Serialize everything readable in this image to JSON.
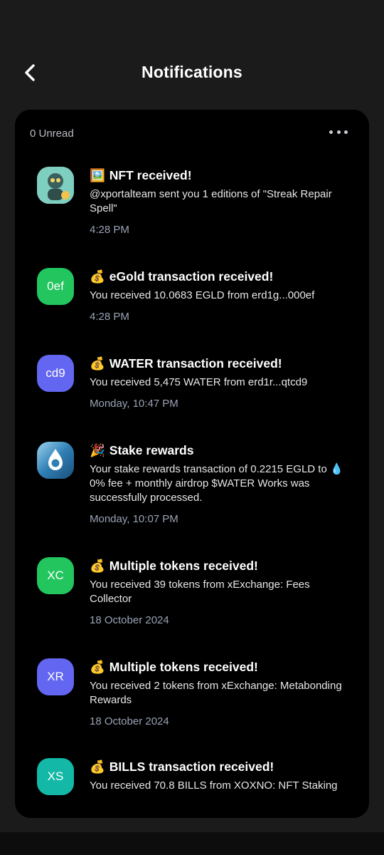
{
  "header": {
    "title": "Notifications",
    "back_icon": "back-arrow-icon"
  },
  "panel": {
    "unread_label": "0 Unread",
    "more_icon": "more-dots-icon"
  },
  "notifications": [
    {
      "emoji": "🖼️",
      "title": "NFT received!",
      "body": "@xportalteam sent you 1 editions of \"Streak Repair Spell\"",
      "time": "4:28 PM",
      "avatar_text": "",
      "avatar_type": "nft-image",
      "avatar_color": "#8fd6c5"
    },
    {
      "emoji": "💰",
      "title": "eGold transaction received!",
      "body": "You received 10.0683 EGLD from erd1g...000ef",
      "time": "4:28 PM",
      "avatar_text": "0ef",
      "avatar_color": "#22c55e"
    },
    {
      "emoji": "💰",
      "title": "WATER transaction received!",
      "body": "You received 5,475 WATER from erd1r...qtcd9",
      "time": "Monday, 10:47 PM",
      "avatar_text": "cd9",
      "avatar_color": "#6366f1"
    },
    {
      "emoji": "🎉",
      "title": "Stake rewards",
      "body": "Your stake rewards transaction of 0.2215 EGLD to 💧 0% fee + monthly airdrop $WATER Works was successfully processed.",
      "time": "Monday, 10:07 PM",
      "avatar_text": "",
      "avatar_type": "water-drop",
      "avatar_color": "#2a6f9a"
    },
    {
      "emoji": "💰",
      "title": "Multiple tokens received!",
      "body": "You received 39 tokens from xExchange: Fees Collector",
      "time": "18 October 2024",
      "avatar_text": "XC",
      "avatar_color": "#22c55e"
    },
    {
      "emoji": "💰",
      "title": "Multiple tokens received!",
      "body": "You received 2 tokens from xExchange: Metabonding Rewards",
      "time": "18 October 2024",
      "avatar_text": "XR",
      "avatar_color": "#6366f1"
    },
    {
      "emoji": "💰",
      "title": "BILLS transaction received!",
      "body": "You received 70.8 BILLS from XOXNO: NFT Staking",
      "time": "",
      "avatar_text": "XS",
      "avatar_color": "#14b8a6"
    }
  ]
}
